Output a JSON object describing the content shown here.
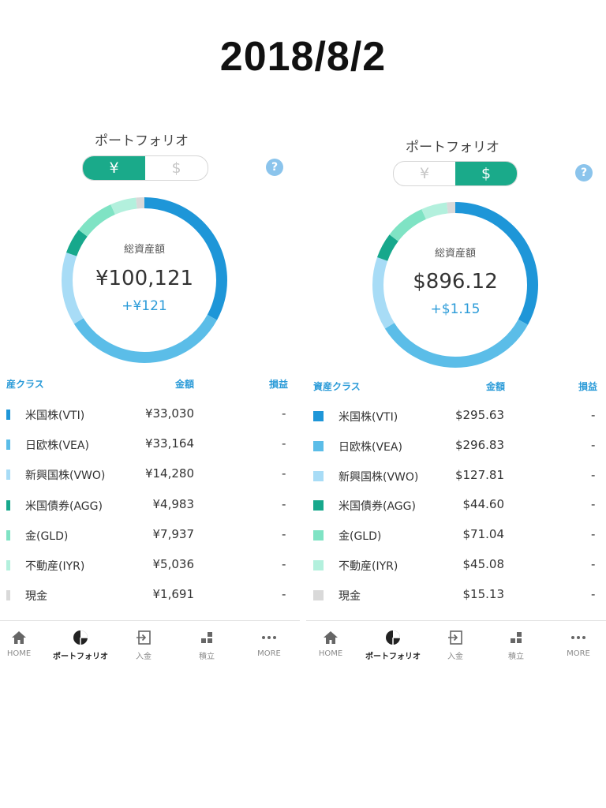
{
  "date_title": "2018/8/2",
  "left": {
    "portfolio_title": "ポートフォリオ",
    "toggle": {
      "yen": "¥",
      "dollar": "$",
      "active": "yen"
    },
    "help": "?",
    "summary": {
      "label": "総資産額",
      "total": "¥100,121",
      "change": "+¥121"
    },
    "headers": {
      "asset_class": "産クラス",
      "amount": "金額",
      "profit_loss": "損益"
    },
    "rows": [
      {
        "name": "米国株(VTI)",
        "amount": "¥33,030",
        "pl": "-",
        "color": "#1e96d8",
        "value": 33030
      },
      {
        "name": "日欧株(VEA)",
        "amount": "¥33,164",
        "pl": "-",
        "color": "#5bbde8",
        "value": 33164
      },
      {
        "name": "新興国株(VWO)",
        "amount": "¥14,280",
        "pl": "-",
        "color": "#a8dcf6",
        "value": 14280
      },
      {
        "name": "米国債券(AGG)",
        "amount": "¥4,983",
        "pl": "-",
        "color": "#17a88c",
        "value": 4983
      },
      {
        "name": "金(GLD)",
        "amount": "¥7,937",
        "pl": "-",
        "color": "#7fe3c4",
        "value": 7937
      },
      {
        "name": "不動産(IYR)",
        "amount": "¥5,036",
        "pl": "-",
        "color": "#b3f0dd",
        "value": 5036
      },
      {
        "name": "現金",
        "amount": "¥1,691",
        "pl": "-",
        "color": "#d9d9d9",
        "value": 1691
      }
    ],
    "nav": [
      {
        "label": "HOME",
        "icon": "home-icon",
        "active": false
      },
      {
        "label": "ポートフォリオ",
        "icon": "pie-chart-icon",
        "active": true
      },
      {
        "label": "入金",
        "icon": "deposit-icon",
        "active": false
      },
      {
        "label": "積立",
        "icon": "grid-icon",
        "active": false
      },
      {
        "label": "MORE",
        "icon": "more-icon",
        "active": false
      }
    ]
  },
  "right": {
    "portfolio_title": "ポートフォリオ",
    "toggle": {
      "yen": "¥",
      "dollar": "$",
      "active": "dollar"
    },
    "help": "?",
    "summary": {
      "label": "総資産額",
      "total": "$896.12",
      "change": "+$1.15"
    },
    "headers": {
      "asset_class": "資産クラス",
      "amount": "金額",
      "profit_loss": "損益"
    },
    "rows": [
      {
        "name": "米国株(VTI)",
        "amount": "$295.63",
        "pl": "-",
        "color": "#1e96d8",
        "value": 295.63
      },
      {
        "name": "日欧株(VEA)",
        "amount": "$296.83",
        "pl": "-",
        "color": "#5bbde8",
        "value": 296.83
      },
      {
        "name": "新興国株(VWO)",
        "amount": "$127.81",
        "pl": "-",
        "color": "#a8dcf6",
        "value": 127.81
      },
      {
        "name": "米国債券(AGG)",
        "amount": "$44.60",
        "pl": "-",
        "color": "#17a88c",
        "value": 44.6
      },
      {
        "name": "金(GLD)",
        "amount": "$71.04",
        "pl": "-",
        "color": "#7fe3c4",
        "value": 71.04
      },
      {
        "name": "不動産(IYR)",
        "amount": "$45.08",
        "pl": "-",
        "color": "#b3f0dd",
        "value": 45.08
      },
      {
        "name": "現金",
        "amount": "$15.13",
        "pl": "-",
        "color": "#d9d9d9",
        "value": 15.13
      }
    ],
    "nav": [
      {
        "label": "HOME",
        "icon": "home-icon",
        "active": false
      },
      {
        "label": "ポートフォリオ",
        "icon": "pie-chart-icon",
        "active": true
      },
      {
        "label": "入金",
        "icon": "deposit-icon",
        "active": false
      },
      {
        "label": "積立",
        "icon": "grid-icon",
        "active": false
      },
      {
        "label": "MORE",
        "icon": "more-icon",
        "active": false
      }
    ]
  }
}
